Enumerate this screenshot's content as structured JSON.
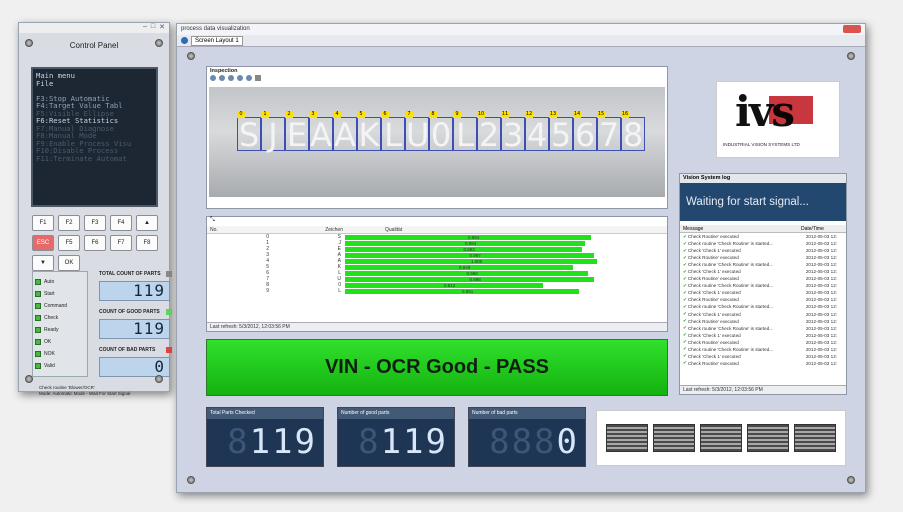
{
  "control_panel": {
    "title": "Control Panel",
    "lcd_lines": [
      {
        "text": "Main menu",
        "cls": "hi"
      },
      {
        "text": "File",
        "cls": "hi"
      },
      {
        "text": "",
        "cls": ""
      },
      {
        "text": "F3:Stop Automatic",
        "cls": ""
      },
      {
        "text": "F4:Target Value Tabl",
        "cls": ""
      },
      {
        "text": "F5:Visible Ellipse",
        "cls": "dim"
      },
      {
        "text": "F6:Reset Statistics",
        "cls": "hi"
      },
      {
        "text": "F7:Manual Diagnose",
        "cls": "dim"
      },
      {
        "text": "F8:Manual Mode",
        "cls": "dim"
      },
      {
        "text": "F9:Enable Process Visu",
        "cls": "dim"
      },
      {
        "text": "F10:Disable Process",
        "cls": "dim"
      },
      {
        "text": "F11:Terminate Automat",
        "cls": "dim"
      }
    ],
    "keys": [
      "F1",
      "F2",
      "F3",
      "F4",
      "▲",
      "ESC",
      "F5",
      "F6",
      "F7",
      "F8",
      "▼",
      "OK"
    ],
    "io": [
      "Auto",
      "Start",
      "Command",
      "Check",
      "Ready",
      "OK",
      "NOK",
      "Valid"
    ],
    "total_label": "TOTAL COUNT OF PARTS",
    "total_value": "119",
    "good_label": "COUNT OF GOOD PARTS",
    "good_value": "119",
    "bad_label": "COUNT OF BAD PARTS",
    "bad_value": "0",
    "note_line1": "Check routine 'Blower/OCR'",
    "note_line2": "Mode: Automatic Mode - Wait For Start Signal"
  },
  "main": {
    "window_title": "process data visualization",
    "tab_label": "Screen Layout 1",
    "inspection_title": "Inspection",
    "ocr_chars": [
      "S",
      "J",
      "E",
      "A",
      "A",
      "K",
      "L",
      "U",
      "0",
      "L",
      "2",
      "3",
      "4",
      "5",
      "6",
      "7",
      "8"
    ],
    "table_headers": {
      "no": "No.",
      "char": "Zeichen",
      "quality": "Qualität"
    },
    "table_rows": [
      {
        "no": "0",
        "char": "S",
        "q": "0.994",
        "w": 0.82
      },
      {
        "no": "1",
        "char": "J",
        "q": "0.984",
        "w": 0.8
      },
      {
        "no": "2",
        "char": "E",
        "q": "0.983",
        "w": 0.79
      },
      {
        "no": "3",
        "char": "A",
        "q": "0.997",
        "w": 0.83
      },
      {
        "no": "4",
        "char": "A",
        "q": "1.000",
        "w": 0.84
      },
      {
        "no": "5",
        "char": "K",
        "q": "0.949",
        "w": 0.76
      },
      {
        "no": "6",
        "char": "L",
        "q": "0.988",
        "w": 0.81
      },
      {
        "no": "7",
        "char": "U",
        "q": "0.998",
        "w": 0.83
      },
      {
        "no": "8",
        "char": "0",
        "q": "0.812",
        "w": 0.66
      },
      {
        "no": "9",
        "char": "L",
        "q": "0.961",
        "w": 0.78
      }
    ],
    "table_refresh": "Last refresh: 5/3/2012, 12:03:56 PM",
    "banner": "VIN - OCR Good - PASS",
    "logo_text": "ivs",
    "logo_sub": "INDUSTRIAL VISION SYSTEMS LTD",
    "logo_color": "#c0141c",
    "vlog_title": "Vision System log",
    "vlog_status": "Waiting for start signal...",
    "vlog_col_msg": "Message",
    "vlog_col_dt": "Date/Time",
    "vlog_rows": [
      "Check Routine' executed",
      "Check routine 'Check Routine' is started...",
      "Check 'Check 1' executed",
      "Check Routine' executed",
      "Check routine 'Check Routine' is started...",
      "Check 'Check 1' executed",
      "Check Routine' executed",
      "Check routine 'Check Routine' is started...",
      "Check 'Check 1' executed",
      "Check Routine' executed",
      "Check routine 'Check Routine' is started...",
      "Check 'Check 1' executed",
      "Check Routine' executed",
      "Check routine 'Check Routine' is started...",
      "Check 'Check 1' executed",
      "Check Routine' executed",
      "Check routine 'Check Routine' is started...",
      "Check 'Check 1' executed",
      "Check Routine' executed"
    ],
    "vlog_date": "2012-05-03 12:",
    "vlog_refresh": "Last refresh: 5/3/2012, 12:03:56 PM",
    "counters": [
      {
        "label": "Total Parts Checked",
        "value": "119"
      },
      {
        "label": "Number of good parts",
        "value": "119"
      },
      {
        "label": "Number of bad parts",
        "value": "0"
      }
    ]
  }
}
